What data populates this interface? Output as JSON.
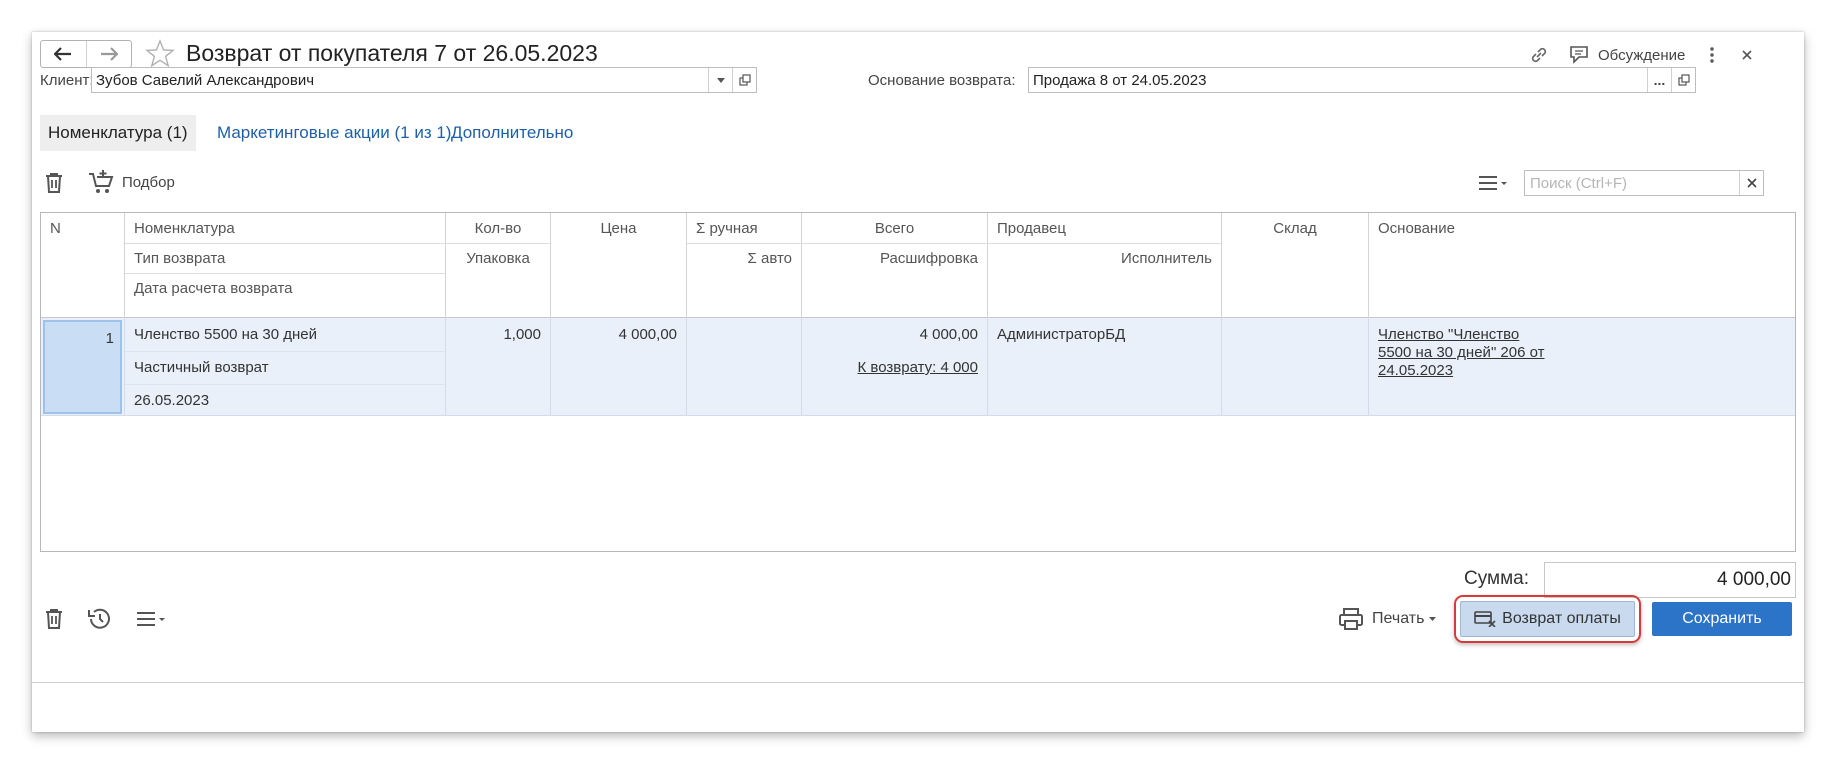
{
  "window": {
    "title": "Возврат от покупателя 7 от 26.05.2023",
    "discussion_label": "Обсуждение"
  },
  "header": {
    "client_label": "Клиент:",
    "client_value": "Зубов Савелий Александрович",
    "basis_label": "Основание возврата:",
    "basis_value": "Продажа 8 от 24.05.2023",
    "basis_select_glyph": "..."
  },
  "tabs": [
    {
      "label": "Номенклатура (1)",
      "active": true
    },
    {
      "label": "Маркетинговые акции (1 из 1)",
      "active": false
    },
    {
      "label": "Дополнительно",
      "active": false
    }
  ],
  "table_toolbar": {
    "pick_label": "Подбор",
    "search_placeholder": "Поиск (Ctrl+F)"
  },
  "table": {
    "headers": {
      "n": "N",
      "nomenclature": "Номенклатура",
      "return_type": "Тип возврата",
      "calc_date": "Дата расчета возврата",
      "qty": "Кол-во",
      "package": "Упаковка",
      "price": "Цена",
      "sum_manual": "Σ ручная",
      "sum_auto": "Σ авто",
      "total": "Всего",
      "breakdown": "Расшифровка",
      "seller": "Продавец",
      "executor": "Исполнитель",
      "warehouse": "Склад",
      "basis": "Основание"
    },
    "rows": [
      {
        "n": "1",
        "nomenclature": "Членство 5500 на 30 дней",
        "return_type": "Частичный возврат",
        "calc_date": "26.05.2023",
        "qty": "1,000",
        "price": "4 000,00",
        "total": "4 000,00",
        "breakdown": "К возврату: 4 000",
        "seller": "АдминистраторБД",
        "basis": "Членство \"Членство 5500 на 30 дней\" 206 от 24.05.2023"
      }
    ]
  },
  "footer": {
    "sum_label": "Сумма:",
    "sum_value": "4 000,00",
    "print_label": "Печать",
    "payment_return_label": "Возврат оплаты",
    "save_label": "Сохранить"
  },
  "colors": {
    "accent": "#2b74c7",
    "link": "#1f5fa8",
    "selected_row": "#e9f0fa",
    "highlight_border": "#d83a3a"
  },
  "icons": [
    "back-arrow-icon",
    "forward-arrow-icon",
    "star-icon",
    "link-icon",
    "discussion-icon",
    "more-vertical-icon",
    "close-icon",
    "dropdown-arrow-icon",
    "open-icon",
    "trash-icon",
    "cart-add-icon",
    "menu-icon",
    "history-icon",
    "printer-icon",
    "card-return-icon"
  ]
}
